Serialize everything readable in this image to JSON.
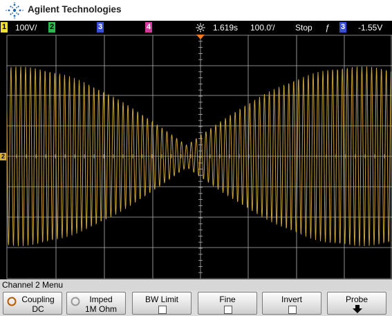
{
  "brand": {
    "name": "Agilent Technologies"
  },
  "status_bar": {
    "ch1_num": "1",
    "ch1_scale": "100V/",
    "ch2_num": "2",
    "ch3_num": "3",
    "ch4_num": "4",
    "timebase_position": "1.619s",
    "timebase_scale": "100.0′/",
    "run_state": "Stop",
    "trigger_slope_symbol": "ƒ",
    "trigger_source_num": "3",
    "trigger_level": "-1.55V"
  },
  "screen": {
    "ground_marker": "2",
    "channel_color": "#d4b03a",
    "trace_color": "#c8a43a",
    "grid_color": "#b4b4b4",
    "signal": "amplitude-modulated sinusoid (beat pattern)"
  },
  "menu": {
    "title": "Channel 2  Menu",
    "softkeys": [
      {
        "label": "Coupling",
        "value": "DC",
        "icon": "rotary-knob-icon"
      },
      {
        "label": "Imped",
        "value": "1M Ohm",
        "icon": "rotary-knob-icon"
      },
      {
        "label": "BW Limit"
      },
      {
        "label": "Fine"
      },
      {
        "label": "Invert"
      },
      {
        "label": "Probe",
        "icon": "down-arrow-icon"
      }
    ]
  }
}
